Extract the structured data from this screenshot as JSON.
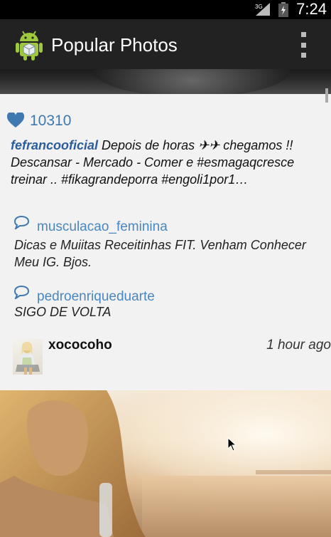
{
  "status_bar": {
    "time": "7:24",
    "network": "3G"
  },
  "app_bar": {
    "title": "Popular Photos",
    "icon": "android-robot-icon",
    "menu_icon": "overflow-menu-icon"
  },
  "post": {
    "likes": "10310",
    "caption_user": "fefrancooficial",
    "caption_text": " Depois de horas ✈✈ chegamos !! Descansar - Mercado - Comer e #esmagaqcresce treinar .. #fikagrandeporra #engoli1por1…",
    "comments": [
      {
        "user": "musculacao_feminina",
        "text": "Dicas e Muiitas Receitinhas FIT. Venham Conhecer Meu IG. Bjos."
      },
      {
        "user": "pedroenriqueduarte",
        "text": "SIGO DE VOLTA"
      }
    ]
  },
  "next_post": {
    "author": "xococoho",
    "time_ago": "1 hour ago"
  },
  "colors": {
    "accent": "#3f79b0",
    "username": "#2b5d9c",
    "app_bar": "#222222",
    "background": "#f2f2f2"
  }
}
